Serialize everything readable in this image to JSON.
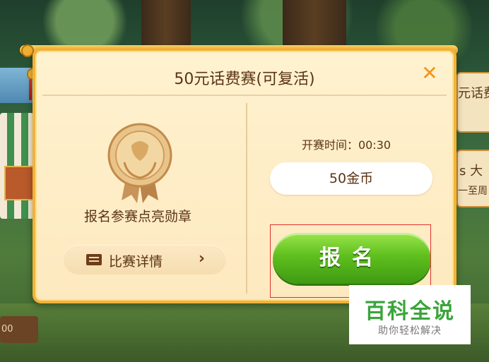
{
  "dialog": {
    "title": "50元话费赛(可复活)",
    "close_symbol": "✕",
    "medal_caption": "报名参赛点亮勋章",
    "details_label": "比赛详情",
    "details_chevron": "›",
    "start_time": "开赛时间：00:30",
    "cost": "50金币",
    "signup_label": "报名"
  },
  "background": {
    "right_sign_text": "元话费",
    "right_sign2_line1": "s 大",
    "right_sign2_line2": "一至周",
    "plank_text": "00"
  },
  "watermark": {
    "brand": "百科全说",
    "tagline": "助你轻松解决"
  },
  "colors": {
    "accent_green": "#5fbf1e",
    "title_brown": "#5b3415",
    "frame_gold": "#f2b23a",
    "highlight_red": "#e03030"
  }
}
